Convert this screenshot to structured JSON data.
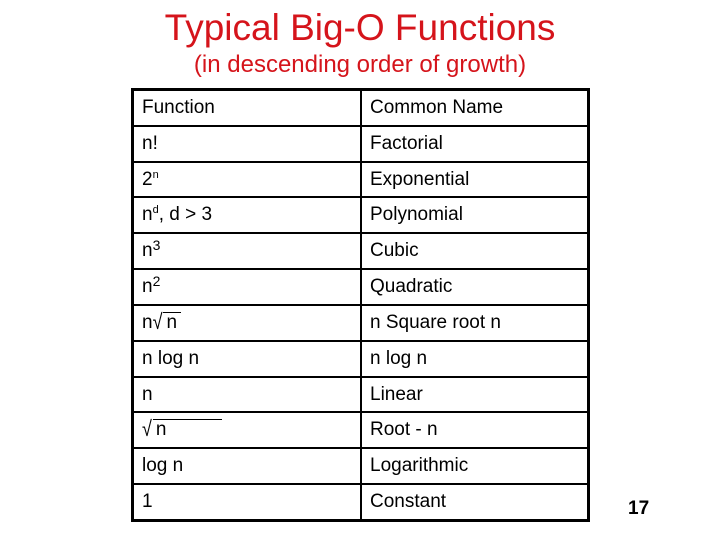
{
  "slide": {
    "title": "Typical Big-O Functions",
    "subtitle": "(in descending order of growth)",
    "title_color": "#d5141b",
    "page_number": "17"
  },
  "table": {
    "headers": [
      "Function",
      "Common Name"
    ],
    "rows": [
      {
        "function": {
          "base": "n!",
          "sup": "",
          "suffix": ""
        },
        "name": "Factorial"
      },
      {
        "function": {
          "base": "2",
          "sup": "n",
          "suffix": ""
        },
        "name": "Exponential"
      },
      {
        "function": {
          "base": "n",
          "sup": "d",
          "suffix": ", d > 3"
        },
        "name": "Polynomial"
      },
      {
        "function": {
          "base": "n",
          "sup": "3",
          "suffix": ""
        },
        "name": "Cubic"
      },
      {
        "function": {
          "base": "n",
          "sup": "2",
          "suffix": ""
        },
        "name": "Quadratic"
      },
      {
        "function": {
          "prefix": "n",
          "radical": "√",
          "radicand": "n"
        },
        "name": "n Square root n"
      },
      {
        "function": {
          "text": "n log n"
        },
        "name": "n log n"
      },
      {
        "function": {
          "text": "n"
        },
        "name": "Linear"
      },
      {
        "function": {
          "radical": "√",
          "radicand": "n"
        },
        "name": "Root - n"
      },
      {
        "function": {
          "text": "log n"
        },
        "name": "Logarithmic"
      },
      {
        "function": {
          "text": "1"
        },
        "name": "Constant"
      }
    ]
  }
}
